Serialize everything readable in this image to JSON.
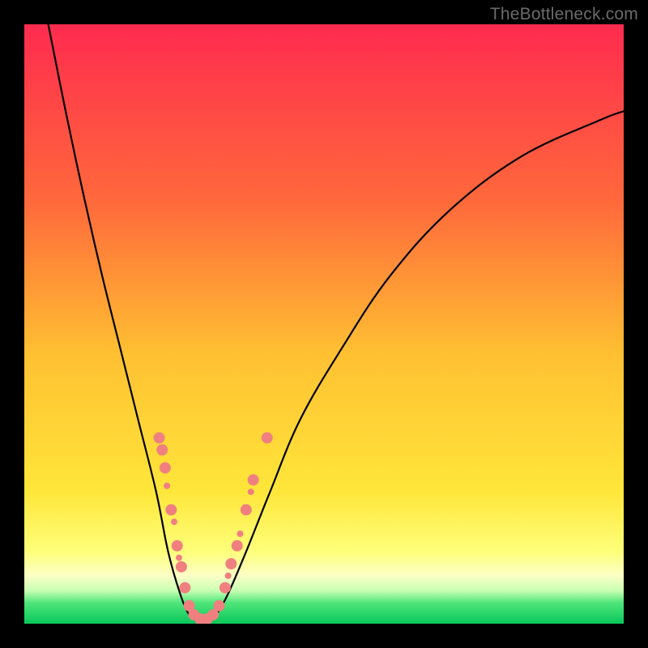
{
  "watermark": {
    "text": "TheBottleneck.com"
  },
  "chart_data": {
    "type": "line",
    "title": "",
    "xlabel": "",
    "ylabel": "",
    "xlim": [
      0,
      100
    ],
    "ylim": [
      0,
      100
    ],
    "grid": false,
    "background_gradient_stops": [
      {
        "offset": 0.0,
        "color": "#ff2b4f"
      },
      {
        "offset": 0.3,
        "color": "#ff6a3b"
      },
      {
        "offset": 0.55,
        "color": "#ffc032"
      },
      {
        "offset": 0.78,
        "color": "#ffe63a"
      },
      {
        "offset": 0.88,
        "color": "#feff7a"
      },
      {
        "offset": 0.92,
        "color": "#fbffc6"
      },
      {
        "offset": 0.945,
        "color": "#c7ffb2"
      },
      {
        "offset": 0.965,
        "color": "#4fe57a"
      },
      {
        "offset": 1.0,
        "color": "#09c75b"
      }
    ],
    "series": [
      {
        "name": "bottleneck-curve",
        "points": [
          {
            "x": 4.0,
            "y": 100.0
          },
          {
            "x": 7.0,
            "y": 85.0
          },
          {
            "x": 10.0,
            "y": 71.0
          },
          {
            "x": 13.0,
            "y": 58.0
          },
          {
            "x": 16.0,
            "y": 46.0
          },
          {
            "x": 19.0,
            "y": 34.0
          },
          {
            "x": 22.0,
            "y": 22.0
          },
          {
            "x": 24.0,
            "y": 12.0
          },
          {
            "x": 26.0,
            "y": 5.0
          },
          {
            "x": 27.5,
            "y": 1.5
          },
          {
            "x": 29.0,
            "y": 0.5
          },
          {
            "x": 30.5,
            "y": 0.5
          },
          {
            "x": 32.0,
            "y": 1.5
          },
          {
            "x": 34.0,
            "y": 5.0
          },
          {
            "x": 37.0,
            "y": 12.0
          },
          {
            "x": 41.0,
            "y": 22.0
          },
          {
            "x": 46.0,
            "y": 34.0
          },
          {
            "x": 53.0,
            "y": 46.0
          },
          {
            "x": 61.0,
            "y": 58.0
          },
          {
            "x": 71.0,
            "y": 69.0
          },
          {
            "x": 83.0,
            "y": 78.0
          },
          {
            "x": 96.0,
            "y": 84.0
          },
          {
            "x": 100.0,
            "y": 85.5
          }
        ]
      }
    ],
    "markers": {
      "name": "highlight-dots",
      "color": "#f08080",
      "radius_small": 4,
      "radius_large": 7,
      "points": [
        {
          "x": 22.5,
          "y": 31.0,
          "r": 7
        },
        {
          "x": 23.0,
          "y": 29.0,
          "r": 7
        },
        {
          "x": 23.5,
          "y": 26.0,
          "r": 7
        },
        {
          "x": 23.8,
          "y": 23.0,
          "r": 4
        },
        {
          "x": 24.5,
          "y": 19.0,
          "r": 7
        },
        {
          "x": 25.0,
          "y": 17.0,
          "r": 4
        },
        {
          "x": 25.5,
          "y": 13.0,
          "r": 7
        },
        {
          "x": 25.8,
          "y": 11.0,
          "r": 4
        },
        {
          "x": 26.2,
          "y": 9.5,
          "r": 7
        },
        {
          "x": 26.8,
          "y": 6.0,
          "r": 7
        },
        {
          "x": 27.5,
          "y": 3.0,
          "r": 7
        },
        {
          "x": 28.3,
          "y": 1.5,
          "r": 7
        },
        {
          "x": 29.3,
          "y": 0.8,
          "r": 7
        },
        {
          "x": 30.5,
          "y": 0.8,
          "r": 7
        },
        {
          "x": 31.5,
          "y": 1.5,
          "r": 7
        },
        {
          "x": 32.5,
          "y": 3.0,
          "r": 7
        },
        {
          "x": 33.5,
          "y": 6.0,
          "r": 7
        },
        {
          "x": 34.0,
          "y": 8.0,
          "r": 4
        },
        {
          "x": 34.5,
          "y": 10.0,
          "r": 7
        },
        {
          "x": 35.5,
          "y": 13.0,
          "r": 7
        },
        {
          "x": 36.0,
          "y": 15.0,
          "r": 4
        },
        {
          "x": 37.0,
          "y": 19.0,
          "r": 7
        },
        {
          "x": 37.8,
          "y": 22.0,
          "r": 4
        },
        {
          "x": 38.2,
          "y": 24.0,
          "r": 7
        },
        {
          "x": 40.5,
          "y": 31.0,
          "r": 7
        }
      ]
    }
  }
}
